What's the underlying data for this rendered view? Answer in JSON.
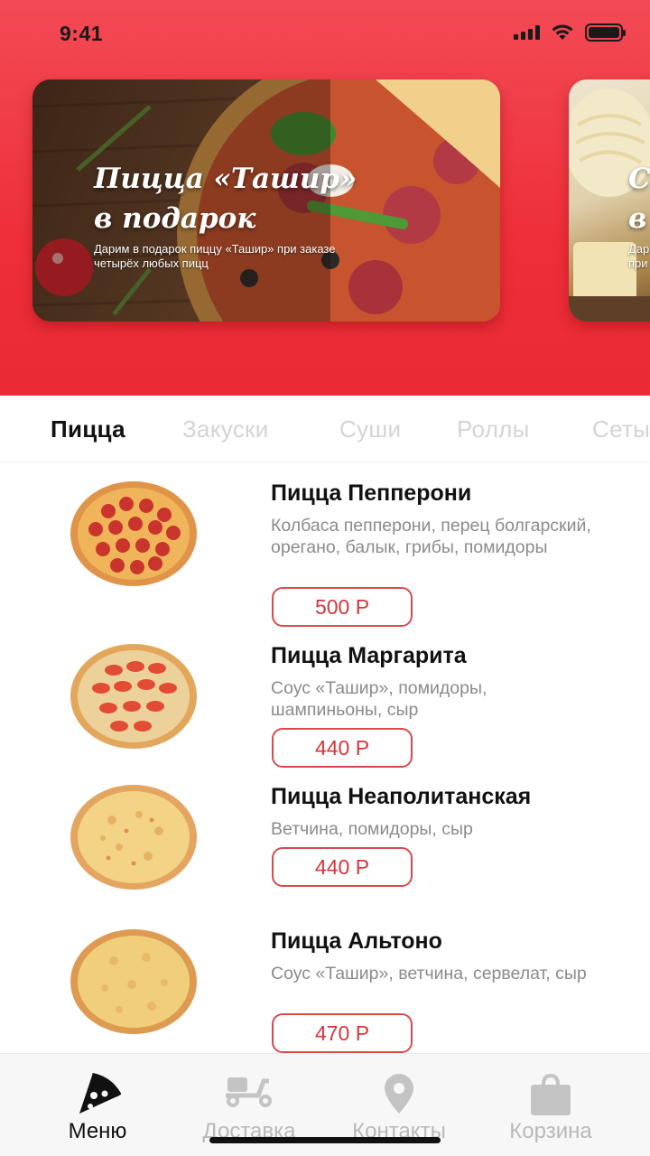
{
  "status_bar": {
    "time": "9:41"
  },
  "banners": [
    {
      "title": "Пицца «Ташир» в подарок",
      "text": "Дарим в подарок пиццу «Ташир» при заказе четырёх любых пицц"
    },
    {
      "title_visible": "С\nв",
      "text_visible": "Дар\nпри"
    }
  ],
  "categories": {
    "active": "Пицца",
    "items": [
      "Пицца",
      "Закуски",
      "Суши",
      "Роллы",
      "Сеты"
    ]
  },
  "menu_items": [
    {
      "name": "Пицца Пепперони",
      "description": "Колбаса пепперони, перец болгарский, орегано, балык, грибы, помидоры",
      "price": "500 Р"
    },
    {
      "name": "Пицца Маргарита",
      "description": "Соус «Ташир», помидоры, шампиньоны, сыр",
      "price": "440 Р"
    },
    {
      "name": "Пицца Неаполитанская",
      "description": "Ветчина, помидоры, сыр",
      "price": "440 Р"
    },
    {
      "name": "Пицца Альтоно",
      "description": "Соус «Ташир», ветчина, сервелат, сыр",
      "price": "470 Р"
    }
  ],
  "tab_bar": {
    "active": "Меню",
    "items": [
      {
        "label": "Меню",
        "icon": "pizza-slice-icon"
      },
      {
        "label": "Доставка",
        "icon": "scooter-icon"
      },
      {
        "label": "Контакты",
        "icon": "location-pin-icon"
      },
      {
        "label": "Корзина",
        "icon": "shopping-bag-icon"
      }
    ]
  },
  "colors": {
    "brand_red": "#ee2f3a",
    "price_border": "#d94a4d",
    "inactive_gray": "#b9b9b9"
  }
}
